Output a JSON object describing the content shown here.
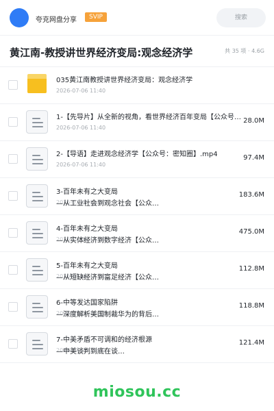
{
  "header": {
    "username": "夸克网盘分享",
    "badge": "SVIP",
    "search_placeholder": "搜索"
  },
  "share": {
    "title": "黄江南-教授讲世界经济变局:观念经济学",
    "summary": "共 35 项 · 4.6G"
  },
  "files": [
    {
      "type": "folder",
      "name": "035黄江南教授讲世界经济变局：观念经济学",
      "date": "2026-07-06 11:40",
      "size": ""
    },
    {
      "type": "file",
      "name": "1-【先导片】从全新的视角，看世界经济百年变局【公众号：密知圈】.mp4",
      "date": "2026-07-06 11:40",
      "size": "28.0M"
    },
    {
      "type": "file",
      "name": "2-【导语】走进观念经济学【公众号：密知圈】.mp4",
      "date": "2026-07-06 11:40",
      "size": "97.4M"
    },
    {
      "type": "file",
      "line1": "3-百年未有之大变局",
      "line2": "—从工业社会到观念社会【公众…",
      "date": "2026-07-06 11:40",
      "size": "183.6M"
    },
    {
      "type": "file",
      "line1": "4-百年未有之大变局",
      "line2": "—从实体经济到数字经济【公众…",
      "date": "2026-07-06 11:40",
      "size": "475.0M"
    },
    {
      "type": "file",
      "line1": "5-百年未有之大变局",
      "line2": "—从短缺经济到富足经济【公众…",
      "date": "2026-07-06 11:40",
      "size": "112.8M"
    },
    {
      "type": "file",
      "line1": "6-中等发达国家陷阱",
      "line2": "—深度解析美国制裁华为的背后…",
      "date": "2026-07-06 11:40",
      "size": "118.8M"
    },
    {
      "type": "file",
      "line1": "7-中美矛盾不可调和的经济根源",
      "line2": "—中美谈判到底在谈…",
      "date": "2026-07-06 11:40",
      "size": "121.4M"
    }
  ],
  "watermark": "miosou.cc",
  "colors": {
    "accent": "#2f7cf6",
    "badge": "#f6a23a",
    "folder": "#f7bf1f",
    "watermark": "#2fc45a"
  },
  "icons": {
    "folder": "folder-icon",
    "file": "document-icon"
  }
}
